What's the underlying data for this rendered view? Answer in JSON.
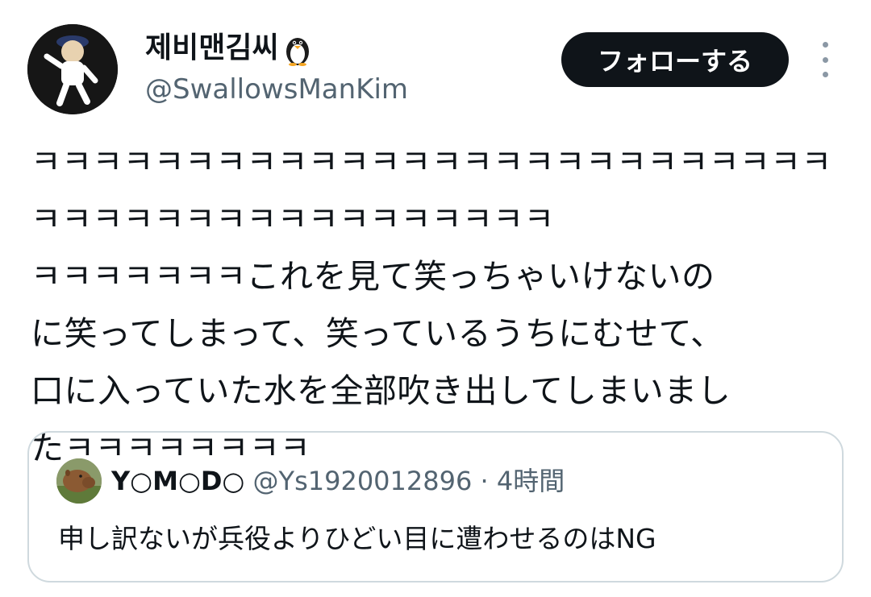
{
  "author": {
    "display_name": "제비맨김씨",
    "emoji": "penguin",
    "handle": "@SwallowsManKim"
  },
  "follow_button": {
    "label": "フォローする"
  },
  "more_menu": {
    "icon": "more-vertical-icon"
  },
  "tweet": {
    "text": "ㅋㅋㅋㅋㅋㅋㅋㅋㅋㅋㅋㅋㅋㅋㅋㅋㅋㅋㅋㅋㅋㅋㅋㅋㅋㅋㅋㅋㅋㅋㅋㅋㅋㅋㅋㅋㅋㅋㅋㅋㅋㅋㅋ\nㅋㅋㅋㅋㅋㅋㅋこれを見て笑っちゃいけないの\nに笑ってしまって、笑っているうちにむせて、\n口に入っていた水を全部吹き出してしまいまし\nたㅋㅋㅋㅋㅋㅋㅋㅋ"
  },
  "quote": {
    "name": "Y○M○D○",
    "handle": "@Ys1920012896",
    "separator": "·",
    "time": "4時間",
    "text": "申し訳ないが兵役よりひどい目に遭わせるのはNG"
  },
  "colors": {
    "text_primary": "#0f1419",
    "text_secondary": "#536471",
    "border": "#cfd9de",
    "button_bg": "#0f1419",
    "button_text": "#ffffff"
  }
}
